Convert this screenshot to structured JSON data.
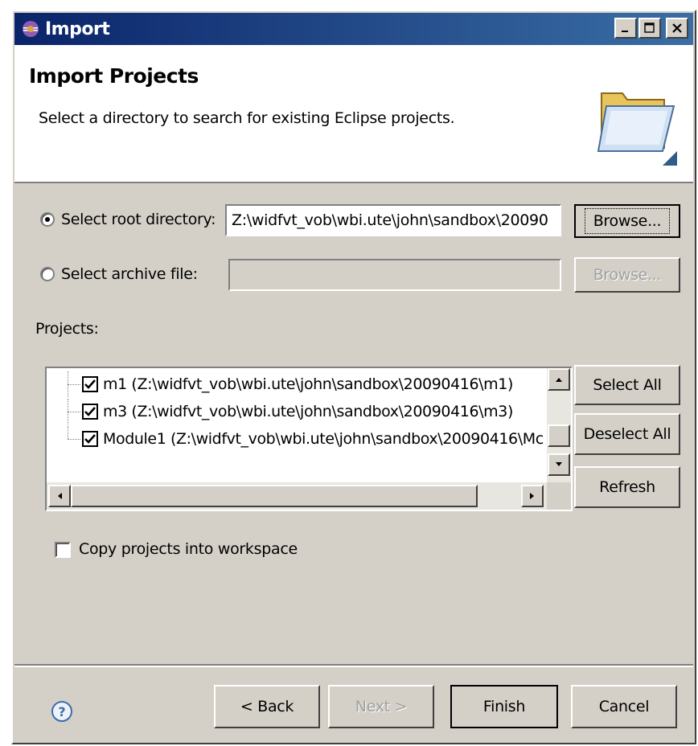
{
  "window": {
    "title": "Import",
    "controls": [
      "minimize",
      "maximize",
      "close"
    ]
  },
  "header": {
    "title": "Import Projects",
    "description": "Select a directory to search for existing Eclipse projects."
  },
  "source": {
    "root_label": "Select root directory:",
    "root_value": "Z:\\widfvt_vob\\wbi.ute\\john\\sandbox\\20090",
    "root_selected": true,
    "root_browse": "Browse...",
    "archive_label": "Select archive file:",
    "archive_value": "",
    "archive_browse": "Browse..."
  },
  "projects": {
    "label": "Projects:",
    "items": [
      {
        "label": "m1 (Z:\\widfvt_vob\\wbi.ute\\john\\sandbox\\20090416\\m1)",
        "checked": true
      },
      {
        "label": "m3 (Z:\\widfvt_vob\\wbi.ute\\john\\sandbox\\20090416\\m3)",
        "checked": true
      },
      {
        "label": "Module1 (Z:\\widfvt_vob\\wbi.ute\\john\\sandbox\\20090416\\Mc",
        "checked": true
      }
    ],
    "select_all": "Select All",
    "deselect_all": "Deselect All",
    "refresh": "Refresh"
  },
  "options": {
    "copy_label": "Copy projects into workspace",
    "copy_checked": false
  },
  "footer": {
    "back": "< Back",
    "next": "Next >",
    "finish": "Finish",
    "cancel": "Cancel"
  }
}
